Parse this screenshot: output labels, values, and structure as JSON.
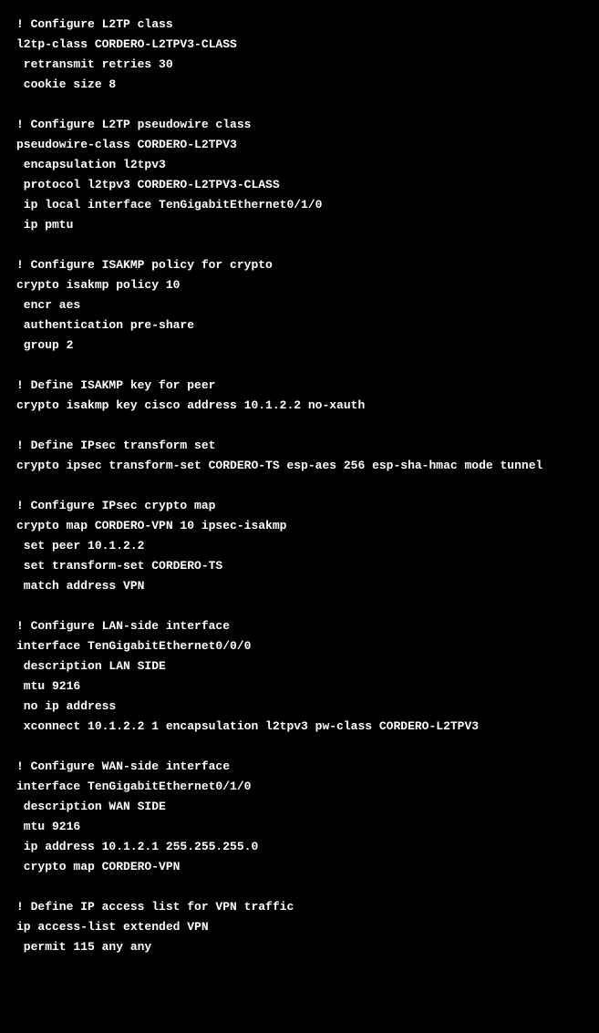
{
  "config_lines": [
    "! Configure L2TP class",
    "l2tp-class CORDERO-L2TPV3-CLASS",
    " retransmit retries 30",
    " cookie size 8",
    "",
    "! Configure L2TP pseudowire class",
    "pseudowire-class CORDERO-L2TPV3",
    " encapsulation l2tpv3",
    " protocol l2tpv3 CORDERO-L2TPV3-CLASS",
    " ip local interface TenGigabitEthernet0/1/0",
    " ip pmtu",
    "",
    "! Configure ISAKMP policy for crypto",
    "crypto isakmp policy 10",
    " encr aes",
    " authentication pre-share",
    " group 2",
    "",
    "! Define ISAKMP key for peer",
    "crypto isakmp key cisco address 10.1.2.2 no-xauth",
    "",
    "! Define IPsec transform set",
    "crypto ipsec transform-set CORDERO-TS esp-aes 256 esp-sha-hmac mode tunnel",
    "",
    "! Configure IPsec crypto map",
    "crypto map CORDERO-VPN 10 ipsec-isakmp",
    " set peer 10.1.2.2",
    " set transform-set CORDERO-TS",
    " match address VPN",
    "",
    "! Configure LAN-side interface",
    "interface TenGigabitEthernet0/0/0",
    " description LAN SIDE",
    " mtu 9216",
    " no ip address",
    " xconnect 10.1.2.2 1 encapsulation l2tpv3 pw-class CORDERO-L2TPV3",
    "",
    "! Configure WAN-side interface",
    "interface TenGigabitEthernet0/1/0",
    " description WAN SIDE",
    " mtu 9216",
    " ip address 10.1.2.1 255.255.255.0",
    " crypto map CORDERO-VPN",
    "",
    "! Define IP access list for VPN traffic",
    "ip access-list extended VPN",
    " permit 115 any any"
  ]
}
